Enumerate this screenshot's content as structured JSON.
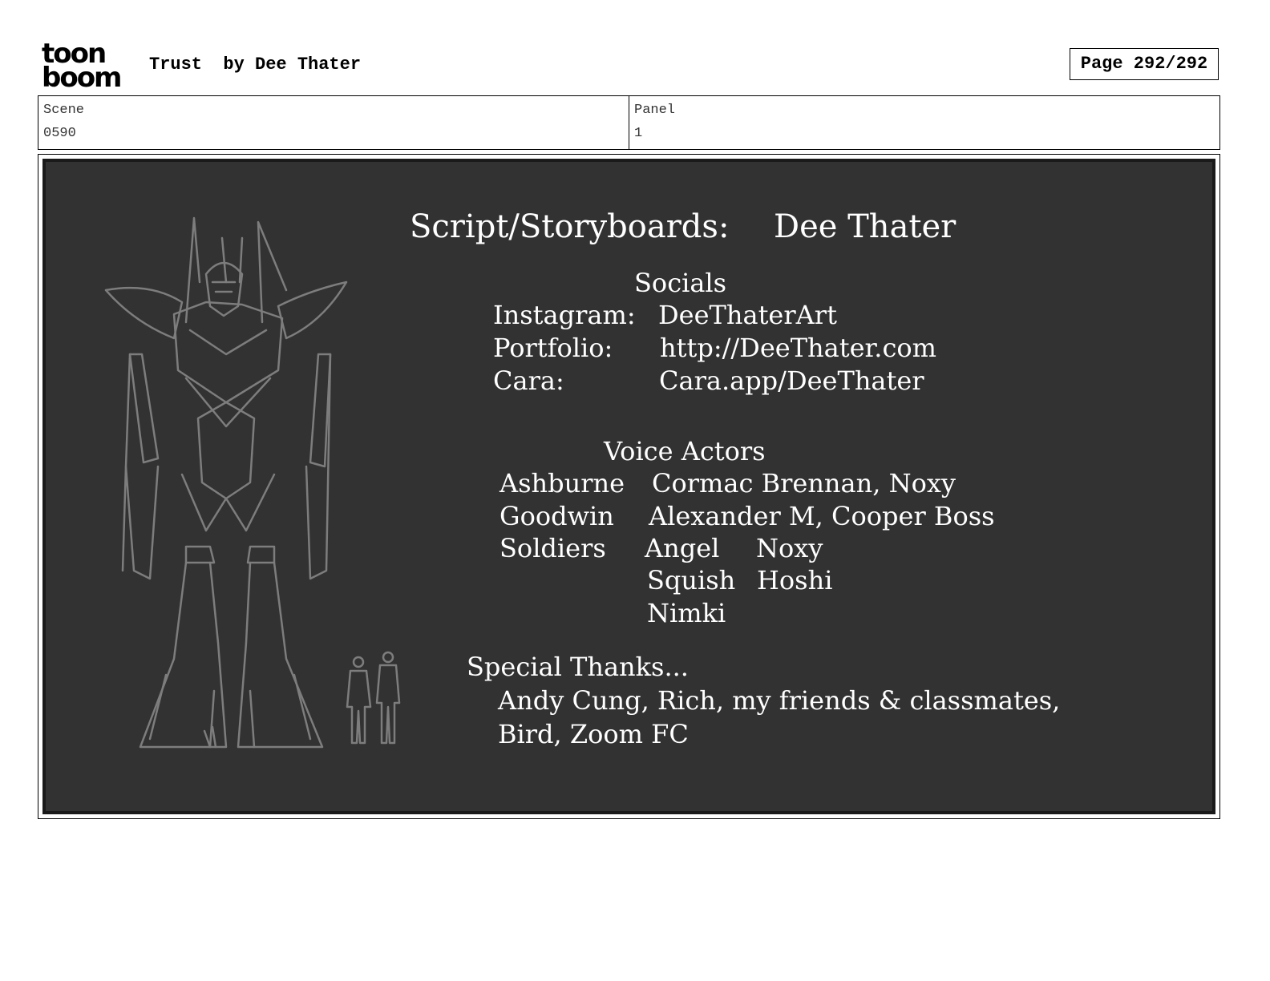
{
  "header": {
    "logo_top": "toon",
    "logo_bottom": "boom",
    "title": "Trust  by Dee Thater",
    "page": "Page 292/292"
  },
  "info": {
    "scene_label": "Scene",
    "scene_value": "0590",
    "panel_label": "Panel",
    "panel_value": "1"
  },
  "credits": {
    "role": "Script/Storyboards:",
    "name": "Dee Thater",
    "socials_heading": "Socials",
    "socials": [
      {
        "label": "Instagram:",
        "value": "DeeThaterArt"
      },
      {
        "label": "Portfolio:",
        "value": "http://DeeThater.com"
      },
      {
        "label": "Cara:",
        "value": "Cara.app/DeeThater"
      }
    ],
    "voice_heading": "Voice Actors",
    "voice": [
      {
        "role": "Ashburne",
        "actors": "Cormac Brennan, Noxy"
      },
      {
        "role": "Goodwin",
        "actors": "Alexander M, Cooper Boss"
      },
      {
        "role": "Soldiers",
        "actors": ""
      }
    ],
    "soldiers": [
      "Angel",
      "Noxy",
      "Squish",
      "Hoshi",
      "Nimki"
    ],
    "thanks_heading": "Special Thanks...",
    "thanks_line1": "Andy Cung, Rich, my friends & classmates,",
    "thanks_line2": "Bird, Zoom FC"
  }
}
